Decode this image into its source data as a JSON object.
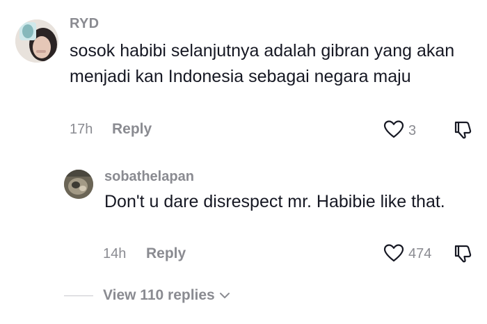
{
  "comment": {
    "username": "RYD",
    "text": "sosok habibi selanjutnya adalah gibran yang akan menjadi kan Indonesia sebagai negara maju",
    "time": "17h",
    "reply_label": "Reply",
    "like_count": "3"
  },
  "reply_comment": {
    "username": "sobathelapan",
    "text": "Don't u dare disrespect mr. Habibie like that.",
    "time": "14h",
    "reply_label": "Reply",
    "like_count": "474"
  },
  "thread": {
    "view_replies_label": "View 110 replies"
  },
  "icons": {
    "like": "heart-outline-icon",
    "dislike": "thumbs-down-outline-icon",
    "expand": "chevron-down-icon"
  },
  "colors": {
    "text_primary": "#161823",
    "text_secondary": "#8a8b91",
    "background": "#ffffff"
  }
}
